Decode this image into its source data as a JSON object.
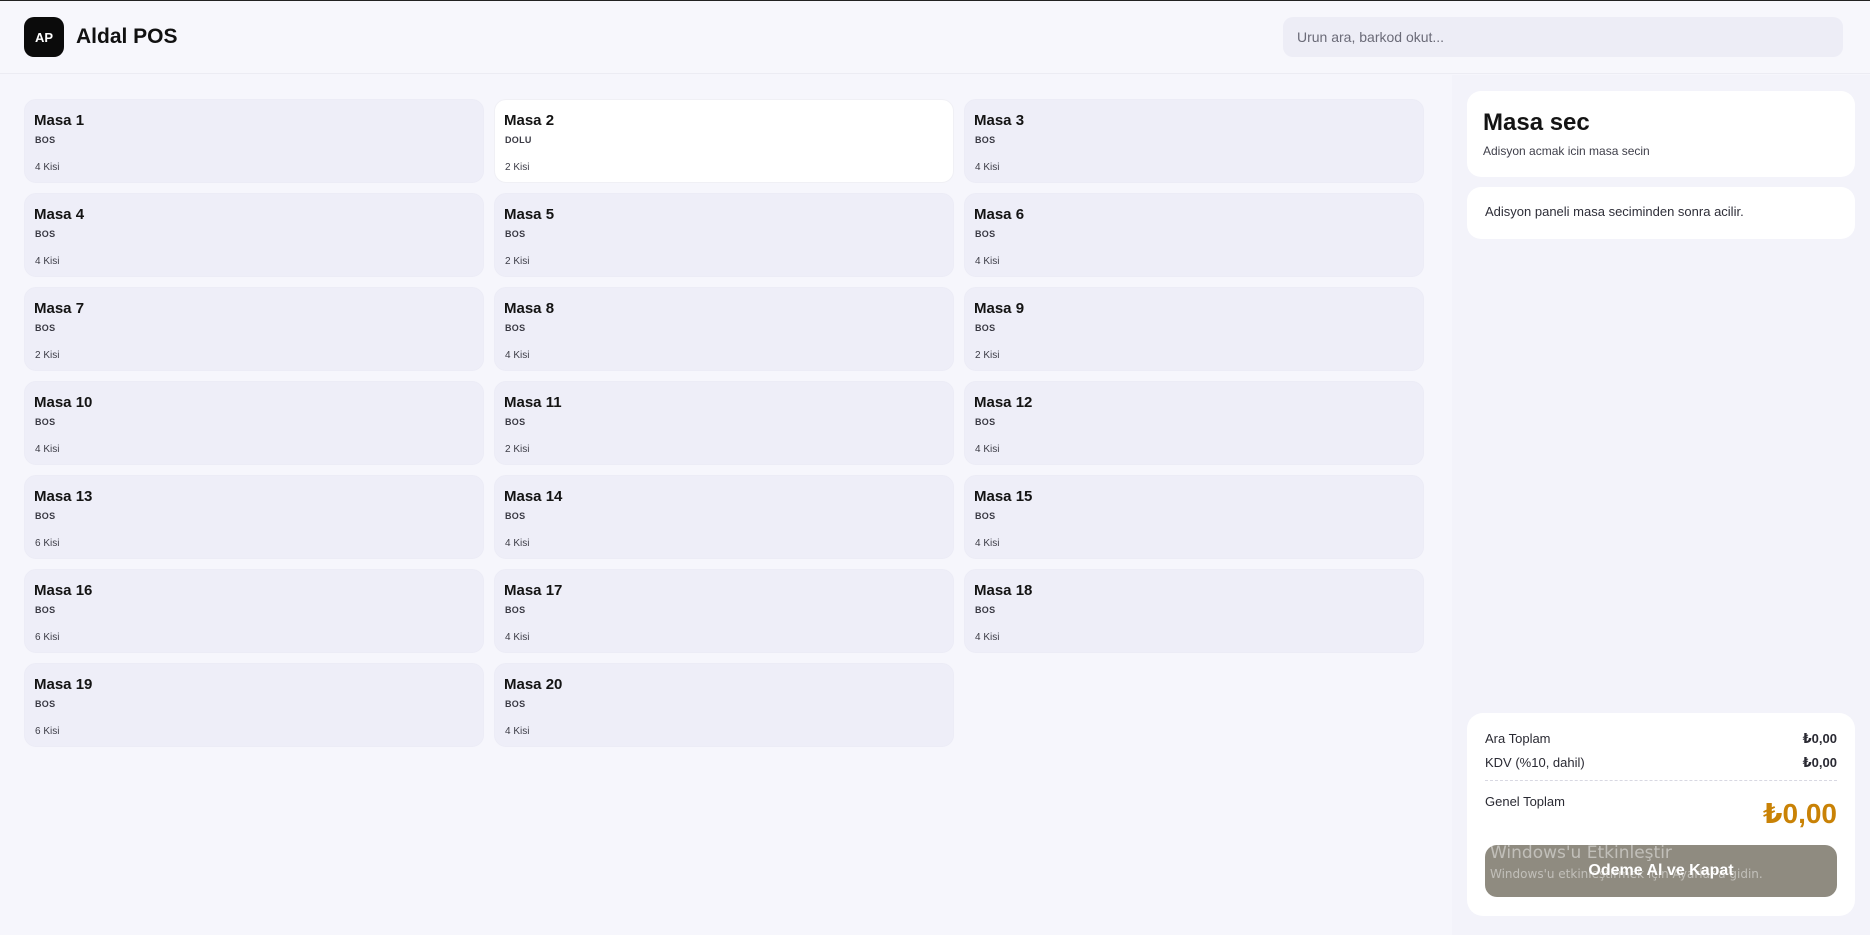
{
  "header": {
    "logo_text": "AP",
    "app_name": "Aldal POS",
    "search_placeholder": "Urun ara, barkod okut..."
  },
  "tables": [
    {
      "name": "Masa 1",
      "status": "BOS",
      "capacity": "4 Kisi"
    },
    {
      "name": "Masa 2",
      "status": "DOLU",
      "capacity": "2 Kisi"
    },
    {
      "name": "Masa 3",
      "status": "BOS",
      "capacity": "4 Kisi"
    },
    {
      "name": "Masa 4",
      "status": "BOS",
      "capacity": "4 Kisi"
    },
    {
      "name": "Masa 5",
      "status": "BOS",
      "capacity": "2 Kisi"
    },
    {
      "name": "Masa 6",
      "status": "BOS",
      "capacity": "4 Kisi"
    },
    {
      "name": "Masa 7",
      "status": "BOS",
      "capacity": "2 Kisi"
    },
    {
      "name": "Masa 8",
      "status": "BOS",
      "capacity": "4 Kisi"
    },
    {
      "name": "Masa 9",
      "status": "BOS",
      "capacity": "2 Kisi"
    },
    {
      "name": "Masa 10",
      "status": "BOS",
      "capacity": "4 Kisi"
    },
    {
      "name": "Masa 11",
      "status": "BOS",
      "capacity": "2 Kisi"
    },
    {
      "name": "Masa 12",
      "status": "BOS",
      "capacity": "4 Kisi"
    },
    {
      "name": "Masa 13",
      "status": "BOS",
      "capacity": "6 Kisi"
    },
    {
      "name": "Masa 14",
      "status": "BOS",
      "capacity": "4 Kisi"
    },
    {
      "name": "Masa 15",
      "status": "BOS",
      "capacity": "4 Kisi"
    },
    {
      "name": "Masa 16",
      "status": "BOS",
      "capacity": "6 Kisi"
    },
    {
      "name": "Masa 17",
      "status": "BOS",
      "capacity": "4 Kisi"
    },
    {
      "name": "Masa 18",
      "status": "BOS",
      "capacity": "4 Kisi"
    },
    {
      "name": "Masa 19",
      "status": "BOS",
      "capacity": "6 Kisi"
    },
    {
      "name": "Masa 20",
      "status": "BOS",
      "capacity": "4 Kisi"
    }
  ],
  "order_panel": {
    "title": "Masa sec",
    "subtitle": "Adisyon acmak icin masa secin",
    "info": "Adisyon paneli masa seciminden sonra acilir."
  },
  "totals": {
    "subtotal_label": "Ara Toplam",
    "subtotal_value": "₺0,00",
    "vat_label": "KDV (%10, dahil)",
    "vat_value": "₺0,00",
    "grand_label": "Genel Toplam",
    "grand_value": "₺0,00",
    "pay_button": "Odeme Al ve Kapat"
  },
  "watermark": {
    "title": "Windows'u Etkinleştir",
    "subtitle": "Windows'u etkinleştirmek için Ayarlar'a gidin."
  },
  "colors": {
    "accent_total": "#c98206",
    "pay_button_bg": "#8f8b80",
    "logo_bg": "#0b0b0b"
  }
}
